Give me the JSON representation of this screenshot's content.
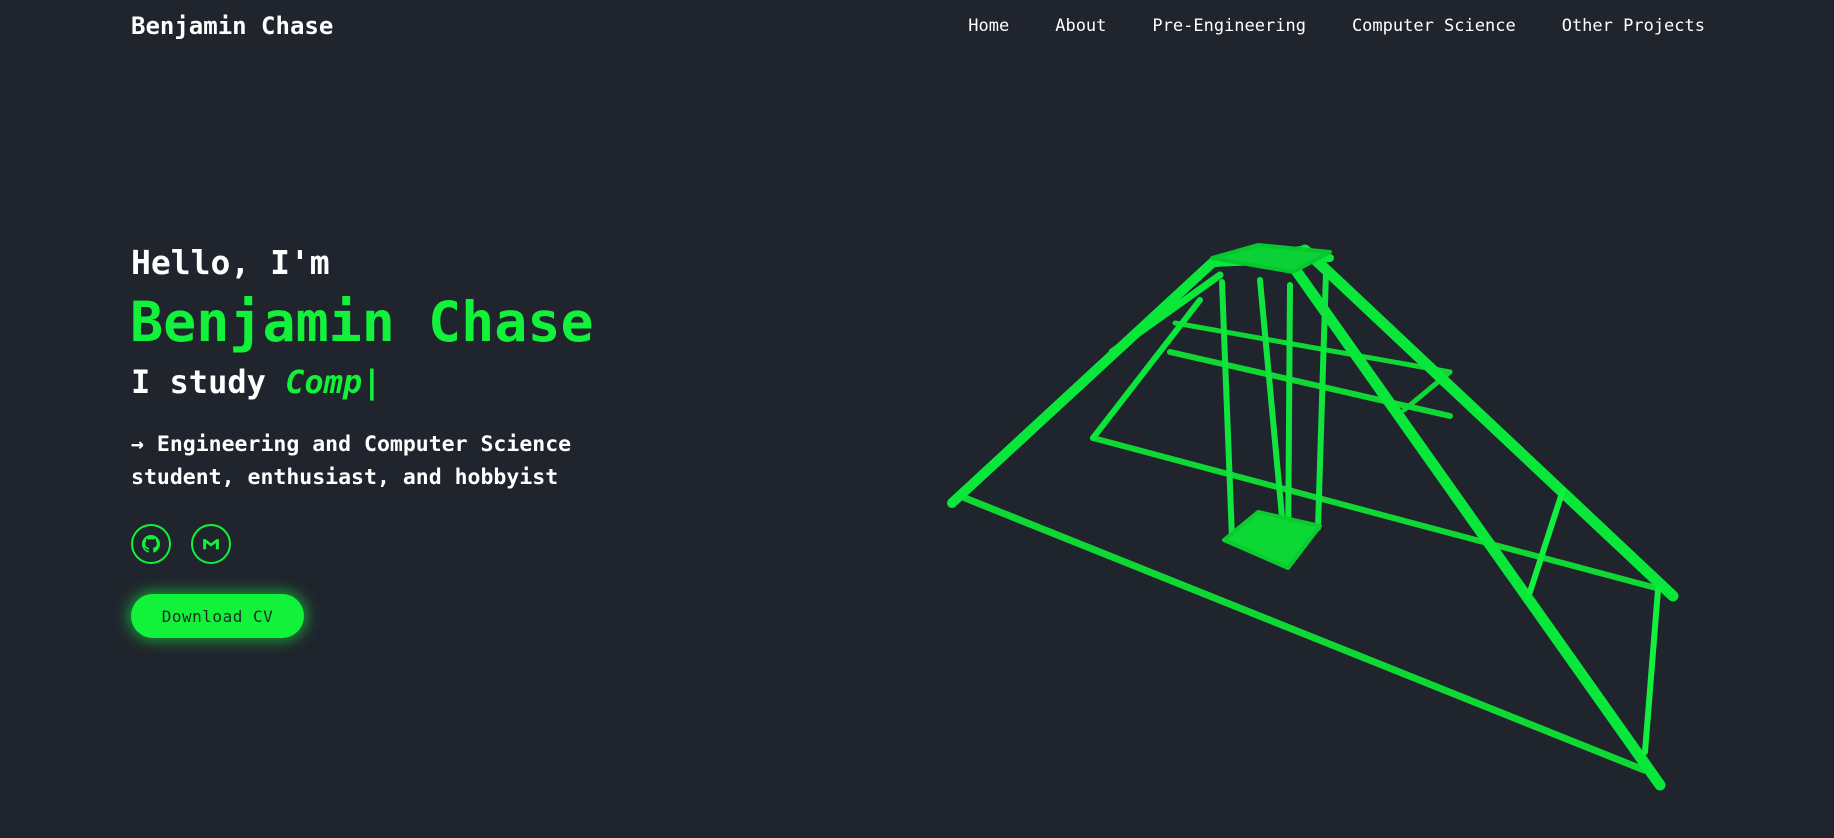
{
  "header": {
    "brand": "Benjamin Chase",
    "nav": [
      {
        "label": "Home"
      },
      {
        "label": "About"
      },
      {
        "label": "Pre-Engineering"
      },
      {
        "label": "Computer Science"
      },
      {
        "label": "Other Projects"
      }
    ]
  },
  "hero": {
    "greeting": "Hello, I'm",
    "name": "Benjamin Chase",
    "study_prefix": "I study ",
    "study_typed": "Comp",
    "caret": "|",
    "description_line1": "→ Engineering and Computer Science",
    "description_line2": "student, enthusiast, and hobbyist",
    "socials": [
      {
        "icon": "github-icon"
      },
      {
        "icon": "gmail-icon"
      }
    ],
    "cv_button": "Download CV"
  },
  "colors": {
    "background": "#20242d",
    "accent": "#12f23b",
    "text": "#ffffff"
  },
  "model": {
    "icon": "wireframe-pyramid-3d-model"
  }
}
